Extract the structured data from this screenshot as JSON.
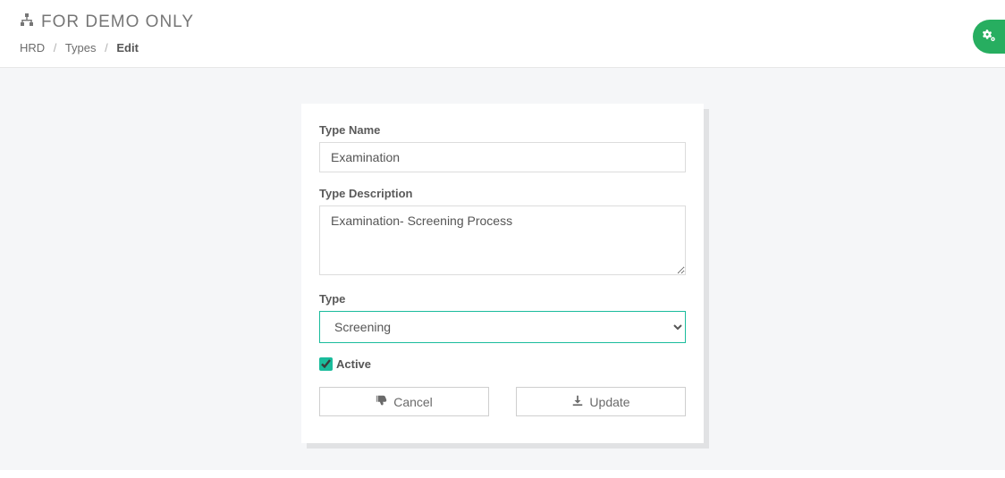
{
  "header": {
    "title": "FOR DEMO ONLY",
    "breadcrumb": {
      "items": [
        "HRD",
        "Types"
      ],
      "current": "Edit"
    }
  },
  "form": {
    "type_name": {
      "label": "Type Name",
      "value": "Examination"
    },
    "type_description": {
      "label": "Type Description",
      "value": "Examination- Screening Process"
    },
    "type": {
      "label": "Type",
      "selected": "Screening"
    },
    "active": {
      "label": "Active",
      "checked": true
    }
  },
  "buttons": {
    "cancel": "Cancel",
    "update": "Update"
  }
}
